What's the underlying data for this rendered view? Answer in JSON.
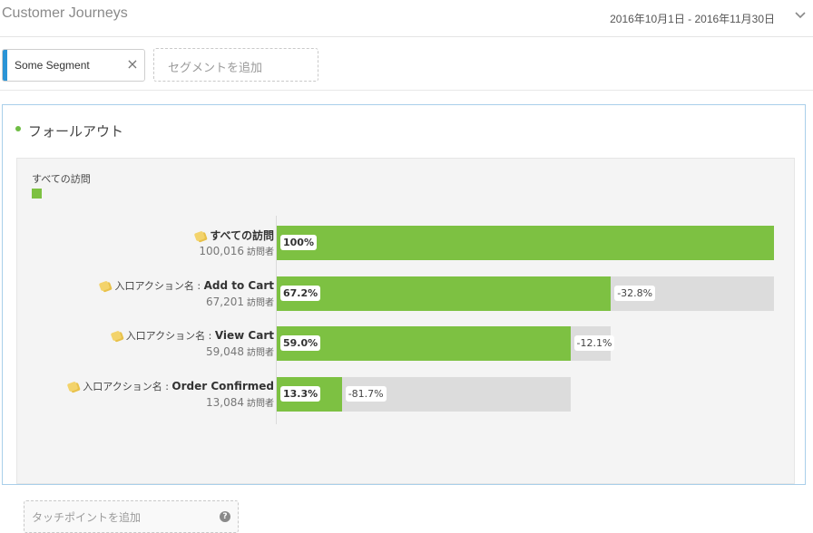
{
  "header": {
    "title": "Customer Journeys",
    "date_range": "2016年10月1日 - 2016年11月30日"
  },
  "segments": {
    "active": "Some Segment",
    "add_placeholder": "セグメントを追加"
  },
  "panel": {
    "title": "フォールアウト"
  },
  "legend": {
    "label": "すべての訪問",
    "color": "#7dc142"
  },
  "colors": {
    "bar": "#7dc142",
    "drop": "#dcdcdc",
    "segment_handle": "#2a94d6"
  },
  "chart_data": {
    "type": "bar",
    "categories": [
      "すべての訪問",
      "Add to Cart",
      "View Cart",
      "Order Confirmed"
    ],
    "values": [
      100016,
      67201,
      59048,
      13084
    ],
    "percent_of_start": [
      100,
      67.2,
      59.0,
      13.3
    ],
    "dropoff_percent": [
      null,
      -32.8,
      -12.1,
      -81.7
    ]
  },
  "steps": [
    {
      "prefix": "",
      "name": "すべての訪問",
      "count": "100,016",
      "unit": "訪問者",
      "pct": "100%",
      "drop": ""
    },
    {
      "prefix": "入口アクション名 : ",
      "name": "Add to Cart",
      "count": "67,201",
      "unit": "訪問者",
      "pct": "67.2%",
      "drop": "-32.8%"
    },
    {
      "prefix": "入口アクション名 : ",
      "name": "View Cart",
      "count": "59,048",
      "unit": "訪問者",
      "pct": "59.0%",
      "drop": "-12.1%"
    },
    {
      "prefix": "入口アクション名 : ",
      "name": "Order Confirmed",
      "count": "13,084",
      "unit": "訪問者",
      "pct": "13.3%",
      "drop": "-81.7%"
    }
  ],
  "touchpoint": {
    "add_label": "タッチポイントを追加"
  }
}
